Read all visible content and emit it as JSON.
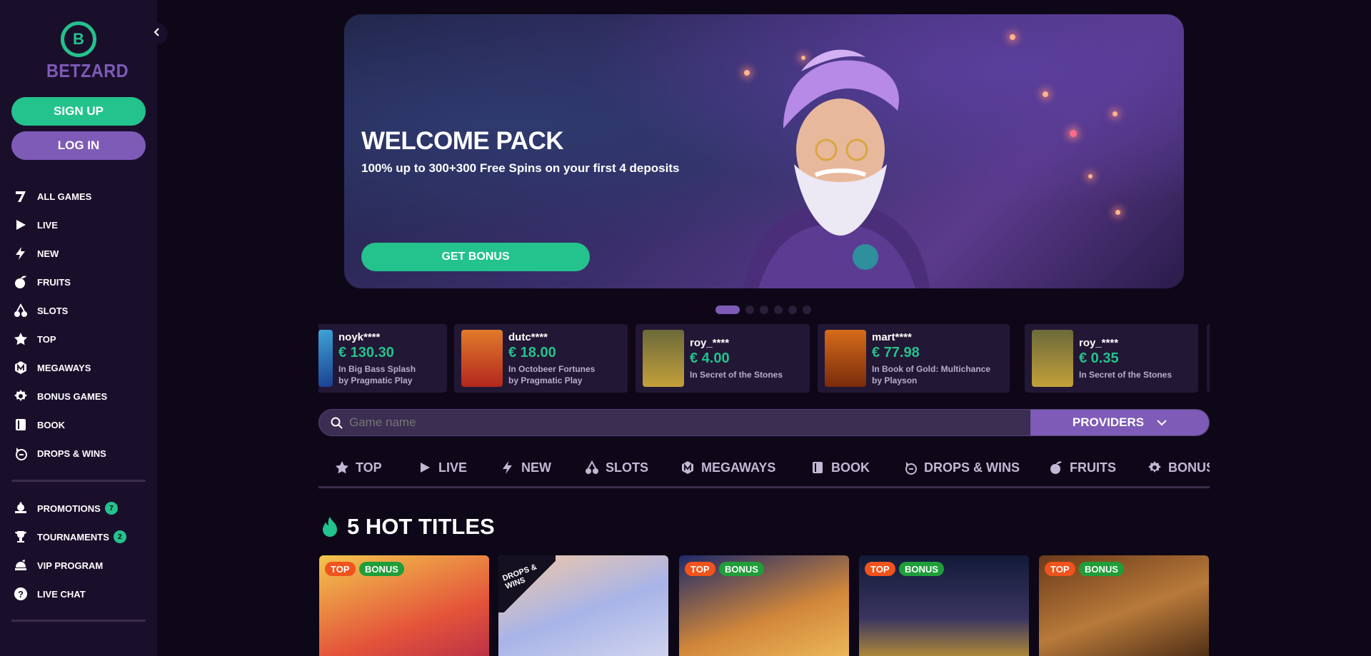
{
  "brand": {
    "name": "BETZARD",
    "logo_letter": "B"
  },
  "auth": {
    "signup_label": "SIGN UP",
    "login_label": "LOG IN"
  },
  "sidebar": {
    "items": [
      {
        "label": "ALL GAMES",
        "icon": "seven-icon"
      },
      {
        "label": "LIVE",
        "icon": "play-icon"
      },
      {
        "label": "NEW",
        "icon": "lightning-icon"
      },
      {
        "label": "FRUITS",
        "icon": "fruit-icon"
      },
      {
        "label": "SLOTS",
        "icon": "cherry-icon"
      },
      {
        "label": "TOP",
        "icon": "star-icon"
      },
      {
        "label": "MEGAWAYS",
        "icon": "megaways-icon"
      },
      {
        "label": "BONUS GAMES",
        "icon": "gear-star-icon"
      },
      {
        "label": "BOOK",
        "icon": "book-icon"
      },
      {
        "label": "DROPS & WINS",
        "icon": "drops-wins-icon"
      }
    ],
    "secondary": [
      {
        "label": "PROMOTIONS",
        "icon": "promo-icon",
        "badge": "7"
      },
      {
        "label": "TOURNAMENTS",
        "icon": "trophy-icon",
        "badge": "2"
      },
      {
        "label": "VIP PROGRAM",
        "icon": "vip-icon"
      },
      {
        "label": "LIVE CHAT",
        "icon": "help-icon"
      }
    ]
  },
  "hero": {
    "title": "WELCOME PACK",
    "subtitle": "100% up to 300+300 Free Spins on your first 4 deposits",
    "cta": "GET BONUS",
    "slides": 6,
    "active_slide": 1
  },
  "winners": [
    {
      "user": "noyk****",
      "amount": "€ 130.30",
      "game_line1": "In Big Bass Splash",
      "game_line2": "by Pragmatic Play"
    },
    {
      "user": "dutc****",
      "amount": "€ 18.00",
      "game_line1": "In Octobeer Fortunes",
      "game_line2": "by Pragmatic Play"
    },
    {
      "user": "roy_****",
      "amount": "€ 4.00",
      "game_line1": "In Secret of the Stones",
      "game_line2": ""
    },
    {
      "user": "mart****",
      "amount": "€ 77.98",
      "game_line1": "In Book of Gold: Multichance",
      "game_line2": "by Playson"
    },
    {
      "user": "roy_****",
      "amount": "€ 0.35",
      "game_line1": "In Secret of the Stones",
      "game_line2": ""
    }
  ],
  "search": {
    "placeholder": "Game name",
    "providers_label": "PROVIDERS"
  },
  "categories": [
    {
      "label": "TOP",
      "icon": "star-icon"
    },
    {
      "label": "LIVE",
      "icon": "play-icon"
    },
    {
      "label": "NEW",
      "icon": "lightning-icon"
    },
    {
      "label": "SLOTS",
      "icon": "cherry-icon"
    },
    {
      "label": "MEGAWAYS",
      "icon": "megaways-icon"
    },
    {
      "label": "BOOK",
      "icon": "book-icon"
    },
    {
      "label": "DROPS & WINS",
      "icon": "drops-wins-icon"
    },
    {
      "label": "FRUITS",
      "icon": "fruit-icon"
    },
    {
      "label": "BONUS",
      "icon": "gear-star-icon"
    }
  ],
  "hot": {
    "title": "5 HOT TITLES",
    "games": [
      {
        "tags": [
          "TOP",
          "BONUS"
        ]
      },
      {
        "ribbon": "DROPS & WINS"
      },
      {
        "tags": [
          "TOP",
          "BONUS"
        ]
      },
      {
        "tags": [
          "TOP",
          "BONUS"
        ]
      },
      {
        "tags": [
          "TOP",
          "BONUS"
        ]
      }
    ]
  },
  "colors": {
    "accent_green": "#24c28c",
    "accent_purple": "#7d5bb7",
    "bg": "#0e0718",
    "sidebar": "#1a0f2b"
  }
}
